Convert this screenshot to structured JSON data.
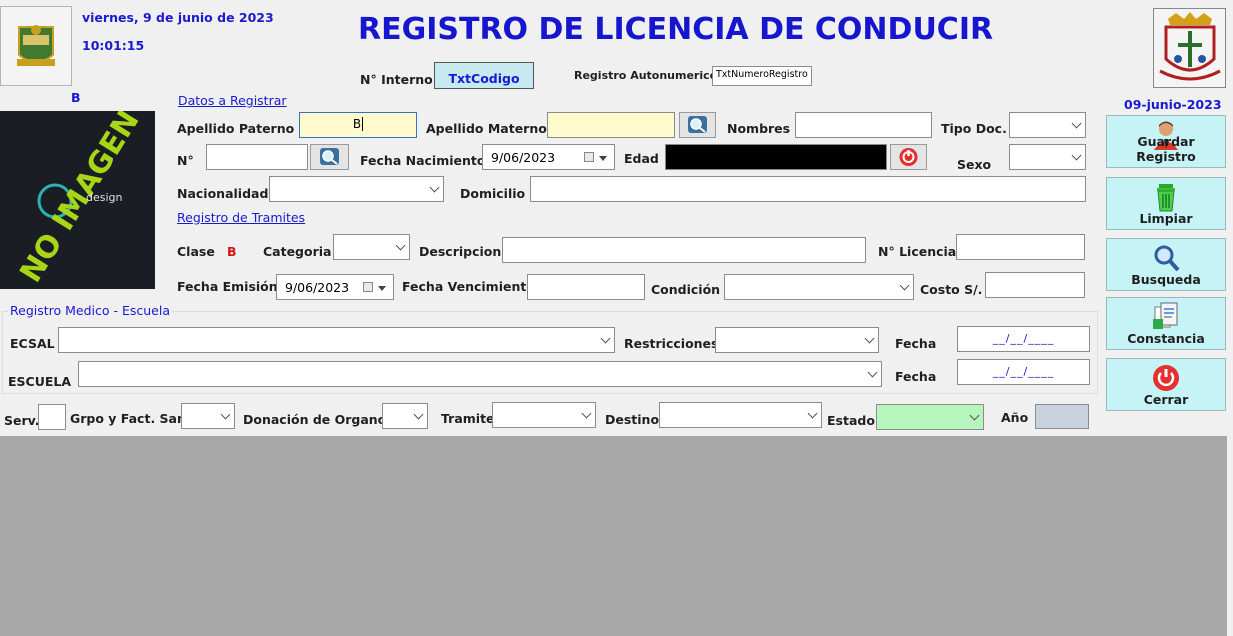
{
  "header": {
    "date": "viernes, 9 de junio de 2023",
    "time": "10:01:15",
    "title": "REGISTRO DE LICENCIA DE CONDUCIR",
    "interno_label": "N° Interno",
    "codigo_button": "TxtCodigo",
    "registro_label": "Registro Autonumerico",
    "registro_value": "TxtNumeroRegistro",
    "side_date": "09-junio-2023"
  },
  "photo": {
    "b_label": "B",
    "no_imagen_text": "NO IMAGEN",
    "watermark_text": "design"
  },
  "datos": {
    "section_title": "Datos a Registrar",
    "apellido_paterno_label": "Apellido Paterno",
    "apellido_paterno_value": "B",
    "apellido_materno_label": "Apellido Materno",
    "nombres_label": "Nombres",
    "tipo_doc_label": "Tipo Doc.",
    "numero_label": "N°",
    "fecha_nac_label": "Fecha Nacimiento",
    "fecha_nac_value": "9/06/2023",
    "edad_label": "Edad",
    "sexo_label": "Sexo",
    "nacionalidad_label": "Nacionalidad",
    "domicilio_label": "Domicilio"
  },
  "tramites": {
    "section_title": "Registro de Tramites",
    "clase_label": "Clase",
    "clase_value": "B",
    "categoria_label": "Categoria",
    "descripcion_label": "Descripcion",
    "licencia_label": "N° Licencia",
    "fecha_emision_label": "Fecha Emisión",
    "fecha_emision_value": "9/06/2023",
    "fecha_venc_label": "Fecha Vencimiento",
    "condicion_label": "Condición",
    "costo_label": "Costo S/."
  },
  "medico": {
    "section_title": "Registro Medico - Escuela",
    "ecsal_label": "ECSAL",
    "restricciones_label": "Restricciones",
    "fecha_label": "Fecha",
    "escuela_label": "ESCUELA",
    "date_mask": "__/__/____"
  },
  "bottom": {
    "serv_label": "Serv.",
    "grupo_label": "Grpo y Fact. Sang.",
    "donacion_label": "Donación de Organos",
    "tramite_label": "Tramite",
    "destino_label": "Destino",
    "estado_label": "Estado",
    "anio_label": "Año"
  },
  "actions": {
    "guardar": "Guardar Registro",
    "limpiar": "Limpiar",
    "busqueda": "Busqueda",
    "constancia": "Constancia",
    "cerrar": "Cerrar"
  },
  "colors": {
    "title_blue": "#1616cf",
    "yellow_field": "#fffacd",
    "side_button": "#c6f3f6",
    "estado_green": "#b6f5bb",
    "detail_gray": "#a8a8a8"
  }
}
